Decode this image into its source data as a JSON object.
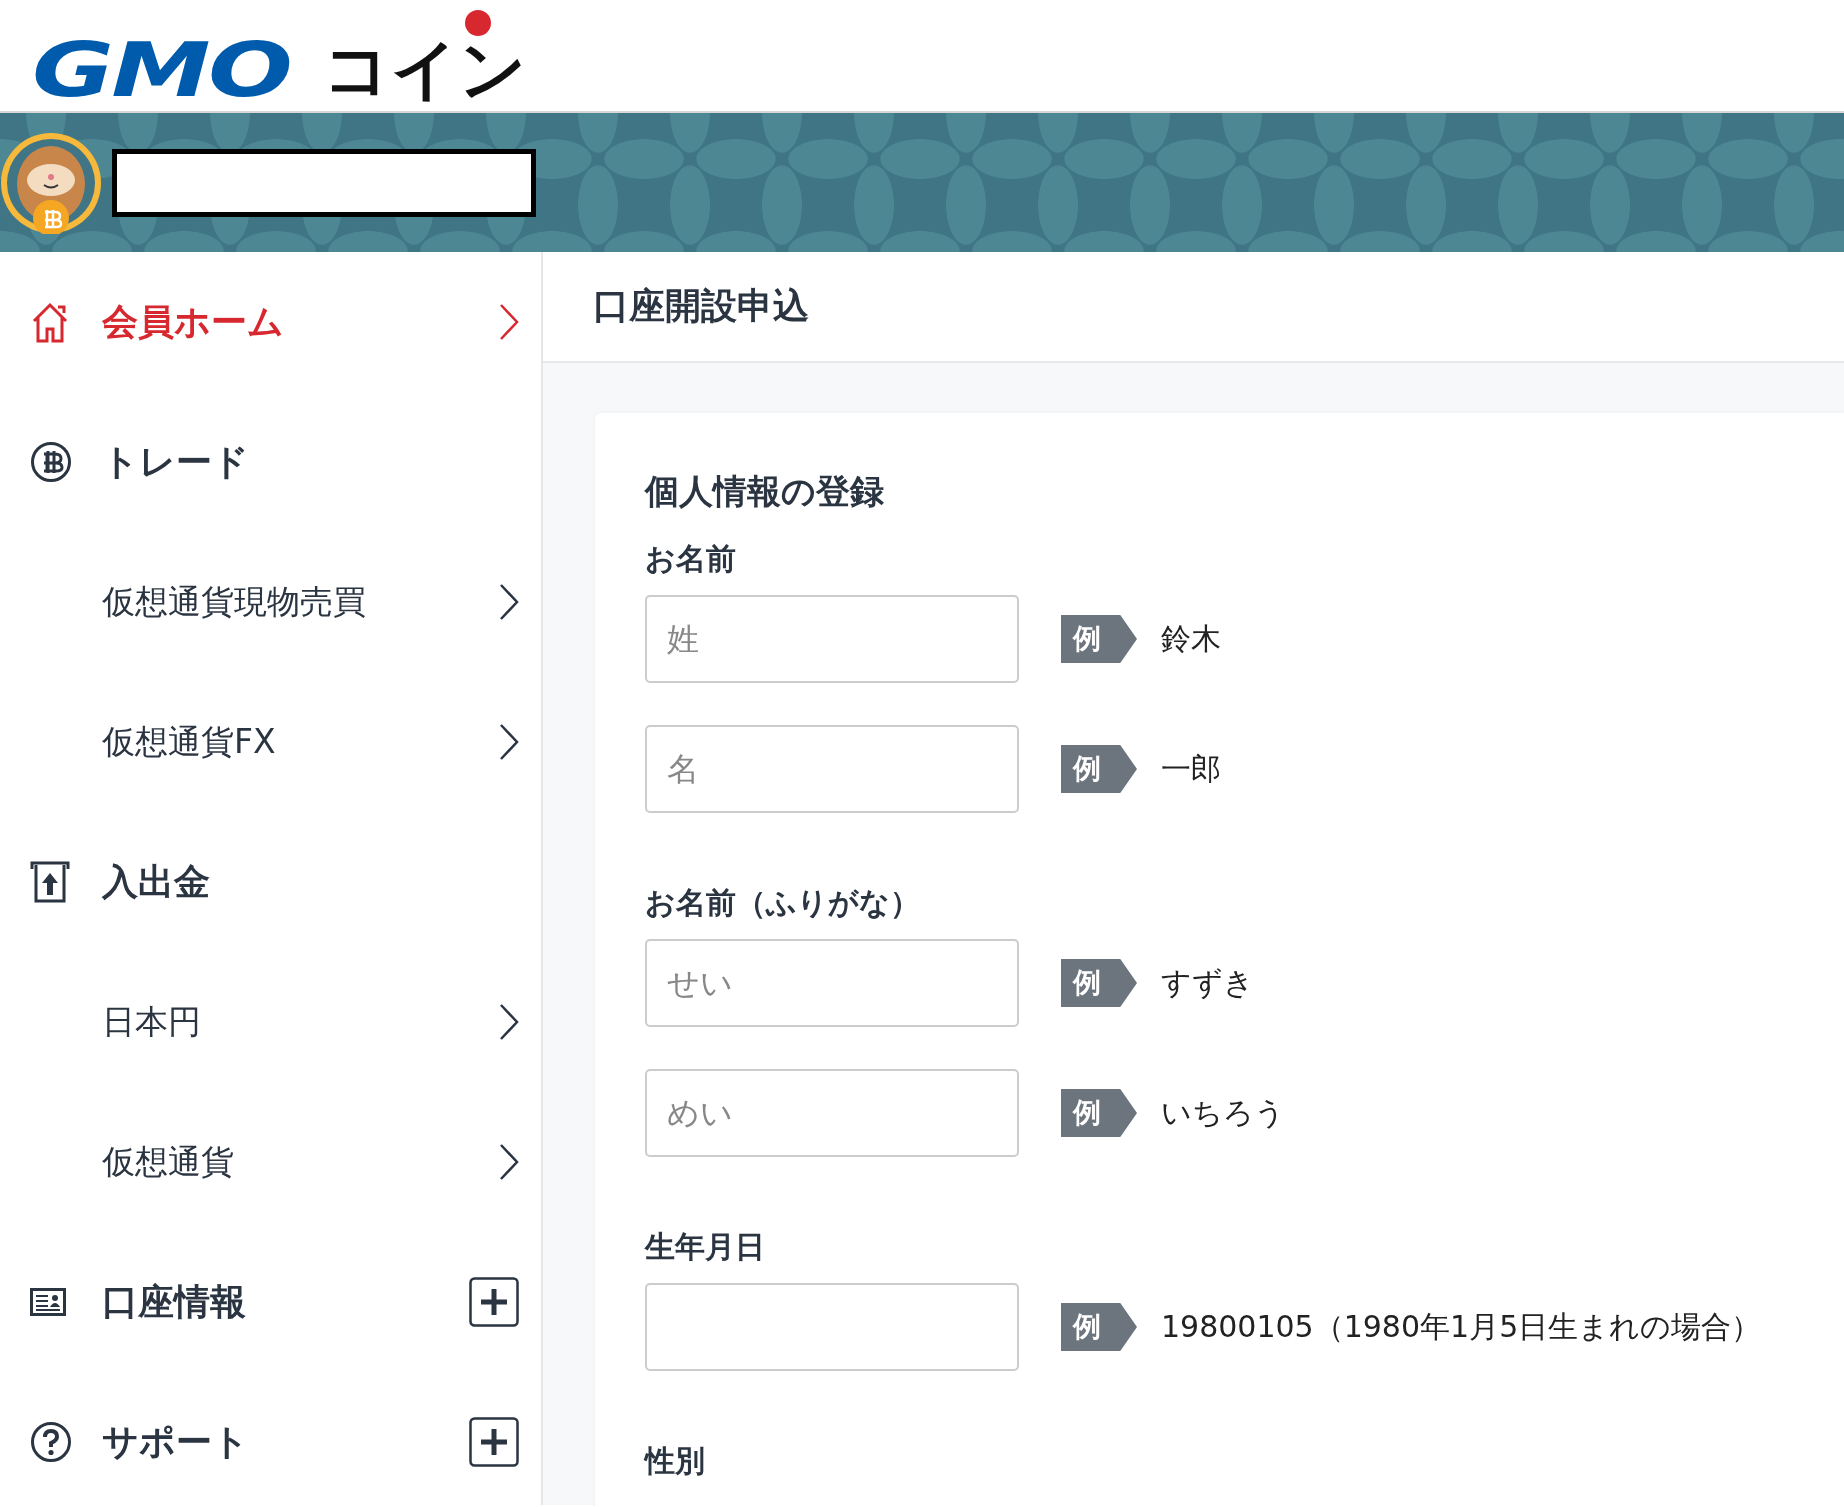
{
  "logo": {
    "brand": "GMO",
    "product": "コイン"
  },
  "sidebar": {
    "items": [
      {
        "label": "会員ホーム",
        "kind": "home",
        "selected": true
      },
      {
        "label": "トレード",
        "kind": "trade",
        "selected": false
      },
      {
        "label": "仮想通貨現物売買",
        "kind": "sub",
        "selected": false
      },
      {
        "label": "仮想通貨FX",
        "kind": "sub",
        "selected": false
      },
      {
        "label": "入出金",
        "kind": "funds",
        "selected": false
      },
      {
        "label": "日本円",
        "kind": "sub",
        "selected": false
      },
      {
        "label": "仮想通貨",
        "kind": "sub",
        "selected": false
      },
      {
        "label": "口座情報",
        "kind": "account",
        "selected": false
      },
      {
        "label": "サポート",
        "kind": "support",
        "selected": false
      }
    ]
  },
  "page_title": "口座開設申込",
  "form": {
    "title": "個人情報の登録",
    "sections": [
      {
        "label": "お名前",
        "fields": [
          {
            "placeholder": "姓",
            "tag": "例",
            "example": "鈴木"
          },
          {
            "placeholder": "名",
            "tag": "例",
            "example": "一郎"
          }
        ]
      },
      {
        "label": "お名前（ふりがな）",
        "fields": [
          {
            "placeholder": "せい",
            "tag": "例",
            "example": "すずき"
          },
          {
            "placeholder": "めい",
            "tag": "例",
            "example": "いちろう"
          }
        ]
      },
      {
        "label": "生年月日",
        "fields": [
          {
            "tag": "例",
            "example": "19800105（1980年1月5日生まれの場合）"
          }
        ]
      },
      {
        "label": "性別"
      }
    ]
  }
}
